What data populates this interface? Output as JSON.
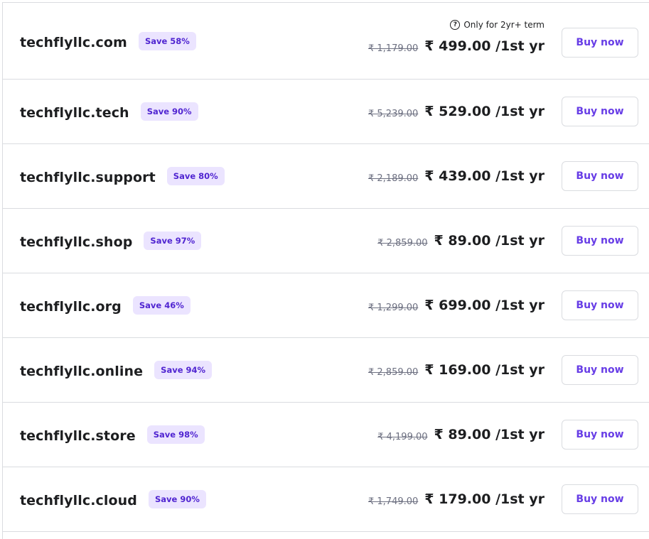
{
  "note": {
    "text": "Only for 2yr+ term",
    "icon": "question-circle-icon"
  },
  "buy_label": "Buy now",
  "rows": [
    {
      "domain": "techflyllc.com",
      "badge": "Save 58%",
      "old_price": "₹ 1,179.00",
      "new_price": "₹ 499.00 /1st yr"
    },
    {
      "domain": "techflyllc.tech",
      "badge": "Save 90%",
      "old_price": "₹ 5,239.00",
      "new_price": "₹ 529.00 /1st yr"
    },
    {
      "domain": "techflyllc.support",
      "badge": "Save 80%",
      "old_price": "₹ 2,189.00",
      "new_price": "₹ 439.00 /1st yr"
    },
    {
      "domain": "techflyllc.shop",
      "badge": "Save 97%",
      "old_price": "₹ 2,859.00",
      "new_price": "₹ 89.00 /1st yr"
    },
    {
      "domain": "techflyllc.org",
      "badge": "Save 46%",
      "old_price": "₹ 1,299.00",
      "new_price": "₹ 699.00 /1st yr"
    },
    {
      "domain": "techflyllc.online",
      "badge": "Save 94%",
      "old_price": "₹ 2,859.00",
      "new_price": "₹ 169.00 /1st yr"
    },
    {
      "domain": "techflyllc.store",
      "badge": "Save 98%",
      "old_price": "₹ 4,199.00",
      "new_price": "₹ 89.00 /1st yr"
    },
    {
      "domain": "techflyllc.cloud",
      "badge": "Save 90%",
      "old_price": "₹ 1,749.00",
      "new_price": "₹ 179.00 /1st yr"
    }
  ],
  "colors": {
    "accent": "#673de6",
    "badge_bg": "#ebe4ff",
    "badge_text": "#5025d1",
    "divider": "#dadce0"
  }
}
